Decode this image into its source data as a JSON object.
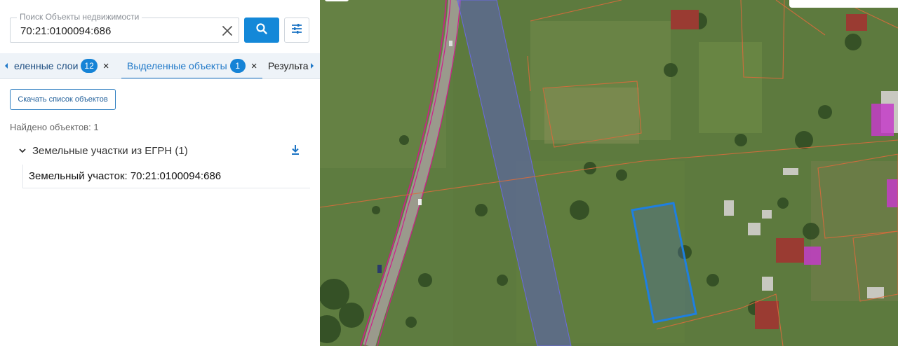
{
  "search": {
    "label": "Поиск Объекты недвижимости",
    "value": "70:21:0100094:686",
    "clear_icon": "close-icon",
    "search_icon": "search-icon",
    "filter_icon": "sliders-icon"
  },
  "tabs": {
    "items": [
      {
        "label": "еленные слои",
        "badge": "12",
        "closable": true,
        "active": false
      },
      {
        "label": "Выделенные объекты",
        "badge": "1",
        "closable": true,
        "active": true
      },
      {
        "label": "Результа",
        "badge": "",
        "closable": false,
        "active": false
      }
    ],
    "close_glyph": "×"
  },
  "actions": {
    "download_list_label": "Скачать список объектов"
  },
  "results": {
    "found_text": "Найдено объектов: 1",
    "group_title": "Земельные участки из ЕГРН (1)",
    "items": [
      {
        "label": "Земельный участок: 70:21:0100094:686"
      }
    ]
  },
  "colors": {
    "accent": "#1488d8",
    "tab_bg": "#eef3f8",
    "selected_parcel": "#1e7fe0",
    "cadastral_boundary": "#d96b3c",
    "zone_overlay": "#5a5ad8",
    "road_boundary": "#d01c8b"
  }
}
